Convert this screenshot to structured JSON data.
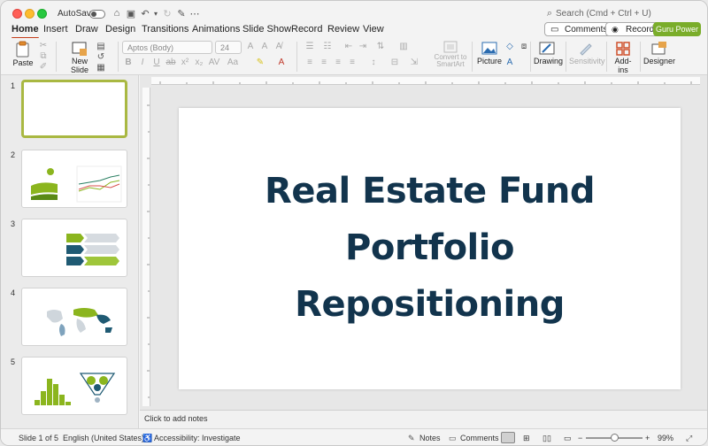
{
  "titlebar": {
    "autosave_label": "AutoSave",
    "search_placeholder": "Search (Cmd + Ctrl + U)"
  },
  "ribbon": {
    "tabs": [
      "Home",
      "Insert",
      "Draw",
      "Design",
      "Transitions",
      "Animations",
      "Slide Show",
      "Record",
      "Review",
      "View"
    ],
    "active_tab": "Home",
    "comments_label": "Comments",
    "record_label": "Record",
    "guru_label": "Guru Power"
  },
  "toolbar": {
    "paste_label": "Paste",
    "new_slide_label": "New Slide",
    "font_name": "Aptos (Body)",
    "font_size": "24",
    "convert_label": "Convert to SmartArt",
    "picture_label": "Picture",
    "drawing_label": "Drawing",
    "sensitivity_label": "Sensitivity",
    "addins_label": "Add-ins",
    "designer_label": "Designer"
  },
  "thumbnails": [
    {
      "number": "1",
      "selected": true
    },
    {
      "number": "2",
      "selected": false
    },
    {
      "number": "3",
      "selected": false
    },
    {
      "number": "4",
      "selected": false
    },
    {
      "number": "5",
      "selected": false
    }
  ],
  "slide": {
    "title_line1": "Real Estate Fund",
    "title_line2": "Portfolio",
    "title_line3": "Repositioning"
  },
  "notes": {
    "placeholder": "Click to add notes"
  },
  "status": {
    "slide_position": "Slide 1 of 5",
    "language": "English (United States)",
    "accessibility": "Accessibility: Investigate",
    "notes_label": "Notes",
    "comments_label": "Comments",
    "zoom": "99%",
    "zoom_fraction": 0.5
  },
  "colors": {
    "accent_tab": "#c43e1c",
    "title_text": "#12344d",
    "thumb_selected": "#a9b842",
    "guru_button": "#7aad2a"
  }
}
